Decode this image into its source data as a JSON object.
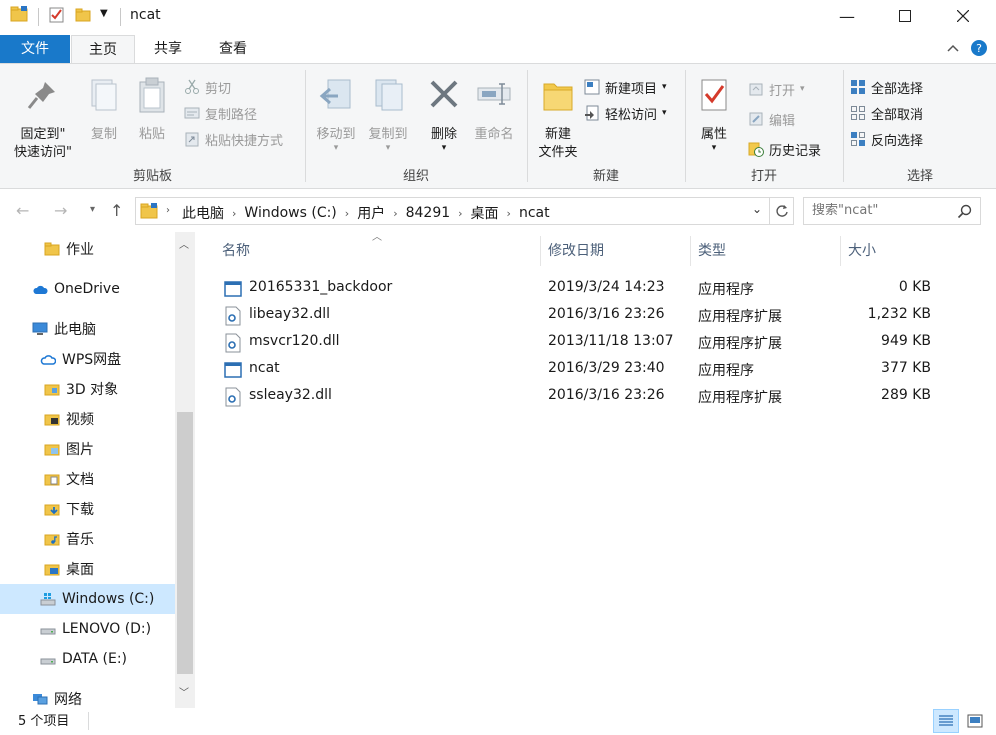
{
  "window": {
    "title": "ncat",
    "minimize": "—",
    "maximize": "☐",
    "close": "✕"
  },
  "tabs": {
    "file": "文件",
    "home": "主页",
    "share": "共享",
    "view": "查看"
  },
  "ribbon": {
    "clipboard": {
      "label": "剪贴板",
      "pin": "固定到\"\n快速访问\"",
      "pin_line1": "固定到\"",
      "pin_line2": "快速访问\"",
      "copy": "复制",
      "paste": "粘贴",
      "cut": "剪切",
      "copy_path": "复制路径",
      "paste_shortcut": "粘贴快捷方式"
    },
    "organize": {
      "label": "组织",
      "move_to": "移动到",
      "copy_to": "复制到",
      "delete": "删除",
      "rename": "重命名"
    },
    "new": {
      "label": "新建",
      "new_folder_line1": "新建",
      "new_folder_line2": "文件夹",
      "new_item": "新建项目",
      "easy_access": "轻松访问"
    },
    "open": {
      "label": "打开",
      "properties": "属性",
      "open": "打开",
      "edit": "编辑",
      "history": "历史记录"
    },
    "select": {
      "label": "选择",
      "select_all": "全部选择",
      "select_none": "全部取消",
      "invert": "反向选择"
    }
  },
  "address": {
    "crumbs": [
      "此电脑",
      "Windows (C:)",
      "用户",
      "84291",
      "桌面",
      "ncat"
    ],
    "search_placeholder": "搜索\"ncat\""
  },
  "sidebar": {
    "items": [
      {
        "label": "作业",
        "icon": "folder-icon"
      },
      {
        "label": "OneDrive",
        "icon": "cloud-icon"
      },
      {
        "label": "此电脑",
        "icon": "computer-icon"
      },
      {
        "label": "WPS网盘",
        "icon": "cloud-icon"
      },
      {
        "label": "3D 对象",
        "icon": "folder-icon"
      },
      {
        "label": "视频",
        "icon": "video-folder-icon"
      },
      {
        "label": "图片",
        "icon": "pictures-folder-icon"
      },
      {
        "label": "文档",
        "icon": "documents-folder-icon"
      },
      {
        "label": "下载",
        "icon": "downloads-folder-icon"
      },
      {
        "label": "音乐",
        "icon": "music-folder-icon"
      },
      {
        "label": "桌面",
        "icon": "desktop-folder-icon"
      },
      {
        "label": "Windows (C:)",
        "icon": "windows-drive-icon"
      },
      {
        "label": "LENOVO (D:)",
        "icon": "drive-icon"
      },
      {
        "label": "DATA (E:)",
        "icon": "drive-icon"
      },
      {
        "label": "网络",
        "icon": "network-icon"
      }
    ]
  },
  "list": {
    "columns": {
      "name": "名称",
      "date": "修改日期",
      "type": "类型",
      "size": "大小"
    },
    "rows": [
      {
        "name": "20165331_backdoor",
        "date": "2019/3/24 14:23",
        "type": "应用程序",
        "size": "0 KB",
        "icon": "exe-icon"
      },
      {
        "name": "libeay32.dll",
        "date": "2016/3/16 23:26",
        "type": "应用程序扩展",
        "size": "1,232 KB",
        "icon": "dll-icon"
      },
      {
        "name": "msvcr120.dll",
        "date": "2013/11/18 13:07",
        "type": "应用程序扩展",
        "size": "949 KB",
        "icon": "dll-icon"
      },
      {
        "name": "ncat",
        "date": "2016/3/29 23:40",
        "type": "应用程序",
        "size": "377 KB",
        "icon": "exe-icon"
      },
      {
        "name": "ssleay32.dll",
        "date": "2016/3/16 23:26",
        "type": "应用程序扩展",
        "size": "289 KB",
        "icon": "dll-icon"
      }
    ]
  },
  "status": {
    "count": "5 个项目"
  }
}
